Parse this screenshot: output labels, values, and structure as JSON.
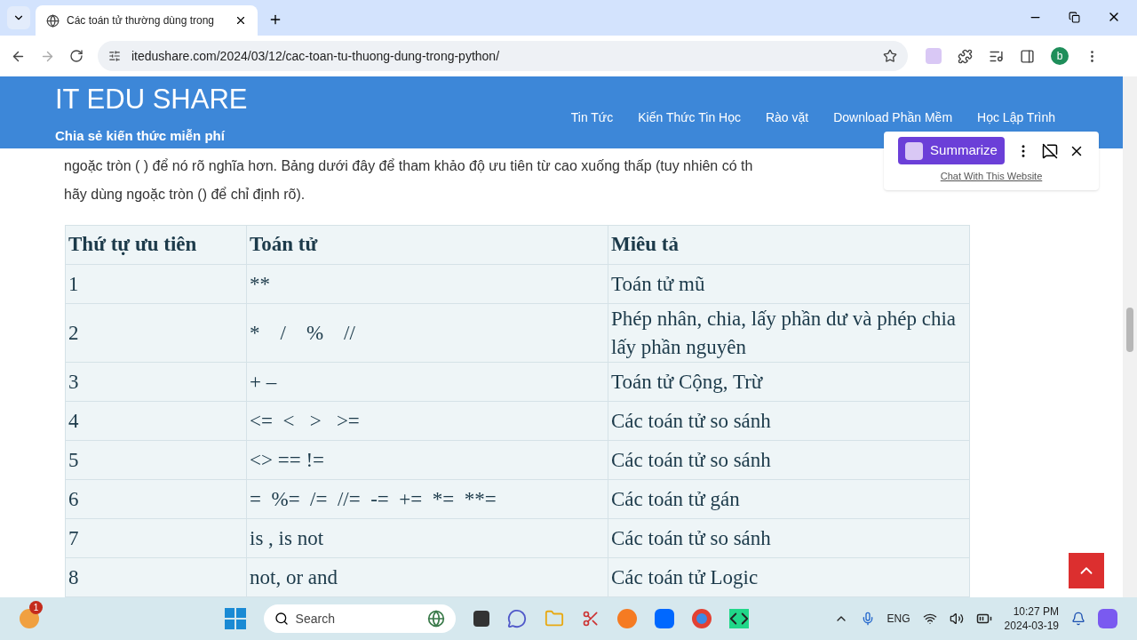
{
  "browser": {
    "tab_title": "Các toán tử thường dùng trong",
    "url": "itedushare.com/2024/03/12/cac-toan-tu-thuong-dung-trong-python/",
    "profile_initial": "b"
  },
  "site_header": {
    "logo": "IT EDU SHARE",
    "tagline": "Chia sẻ kiến thức miễn phí",
    "nav": [
      "Tin Tức",
      "Kiến Thức Tin Học",
      "Rào vặt",
      "Download Phần Mềm",
      "Học Lập Trình"
    ]
  },
  "article": {
    "lines": [
      "ngoặc tròn ( ) để nó rõ nghĩa hơn. Bảng dưới đây để tham khảo độ ưu tiên từ cao xuống thấp (tuy nhiên có th",
      "hãy dùng ngoặc tròn () để chỉ định rõ)."
    ]
  },
  "table": {
    "columns": [
      "Thứ tự ưu tiên",
      "Toán tử",
      "Miêu tả"
    ],
    "rows": [
      [
        "1",
        "**",
        "Toán tử mũ"
      ],
      [
        "2",
        "*    /    %    //",
        "Phép nhân, chia, lấy phần dư và phép chia lấy phần nguyên"
      ],
      [
        "3",
        "+ –",
        "Toán tử Cộng, Trừ"
      ],
      [
        "4",
        "<=  <   >   >=",
        "Các toán tử so sánh"
      ],
      [
        "5",
        "<> == !=",
        "Các toán tử so sánh"
      ],
      [
        "6",
        "=  %=  /=  //=  -=  +=  *=  **=",
        "Các toán tử gán"
      ],
      [
        "7",
        "is , is not",
        "Các toán tử so sánh"
      ],
      [
        "8",
        "not, or and",
        "Các toán tử Logic"
      ]
    ]
  },
  "widget": {
    "button": "Summarize",
    "link": "Chat With This Website"
  },
  "taskbar": {
    "weather_badge": "1",
    "search": "Search",
    "language": "ENG",
    "time": "10:27 PM",
    "date": "2024-03-19"
  }
}
